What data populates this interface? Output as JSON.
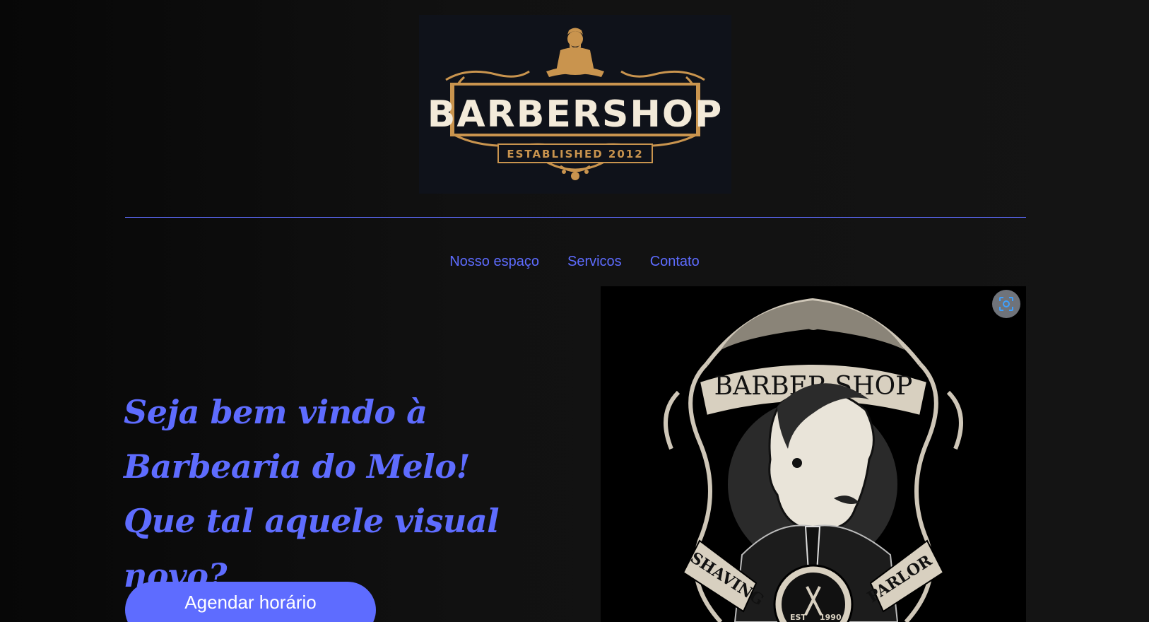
{
  "logo": {
    "text": "BARBERSHOP",
    "subtext": "ESTABLISHED 2012",
    "colors": {
      "gold": "#c9944e",
      "cream": "#f3ead9",
      "background": "#0f121a"
    }
  },
  "nav": {
    "items": [
      {
        "label": "Nosso espaço"
      },
      {
        "label": "Servicos"
      },
      {
        "label": "Contato"
      }
    ]
  },
  "hero": {
    "title": "Seja bem vindo à Barbearia do Melo! Que tal aquele visual novo?",
    "cta_label": "Agendar horário"
  },
  "hero_image": {
    "banner_text": "BARBER SHOP",
    "left_ribbon": "SHAVING",
    "right_ribbon": "PARLOR",
    "est_text": "EST",
    "est_year": "1990"
  },
  "lens_icon": "visual-search-icon",
  "colors": {
    "accent": "#5e6cff",
    "page_background": "#111111",
    "button_text": "#ffffff"
  }
}
